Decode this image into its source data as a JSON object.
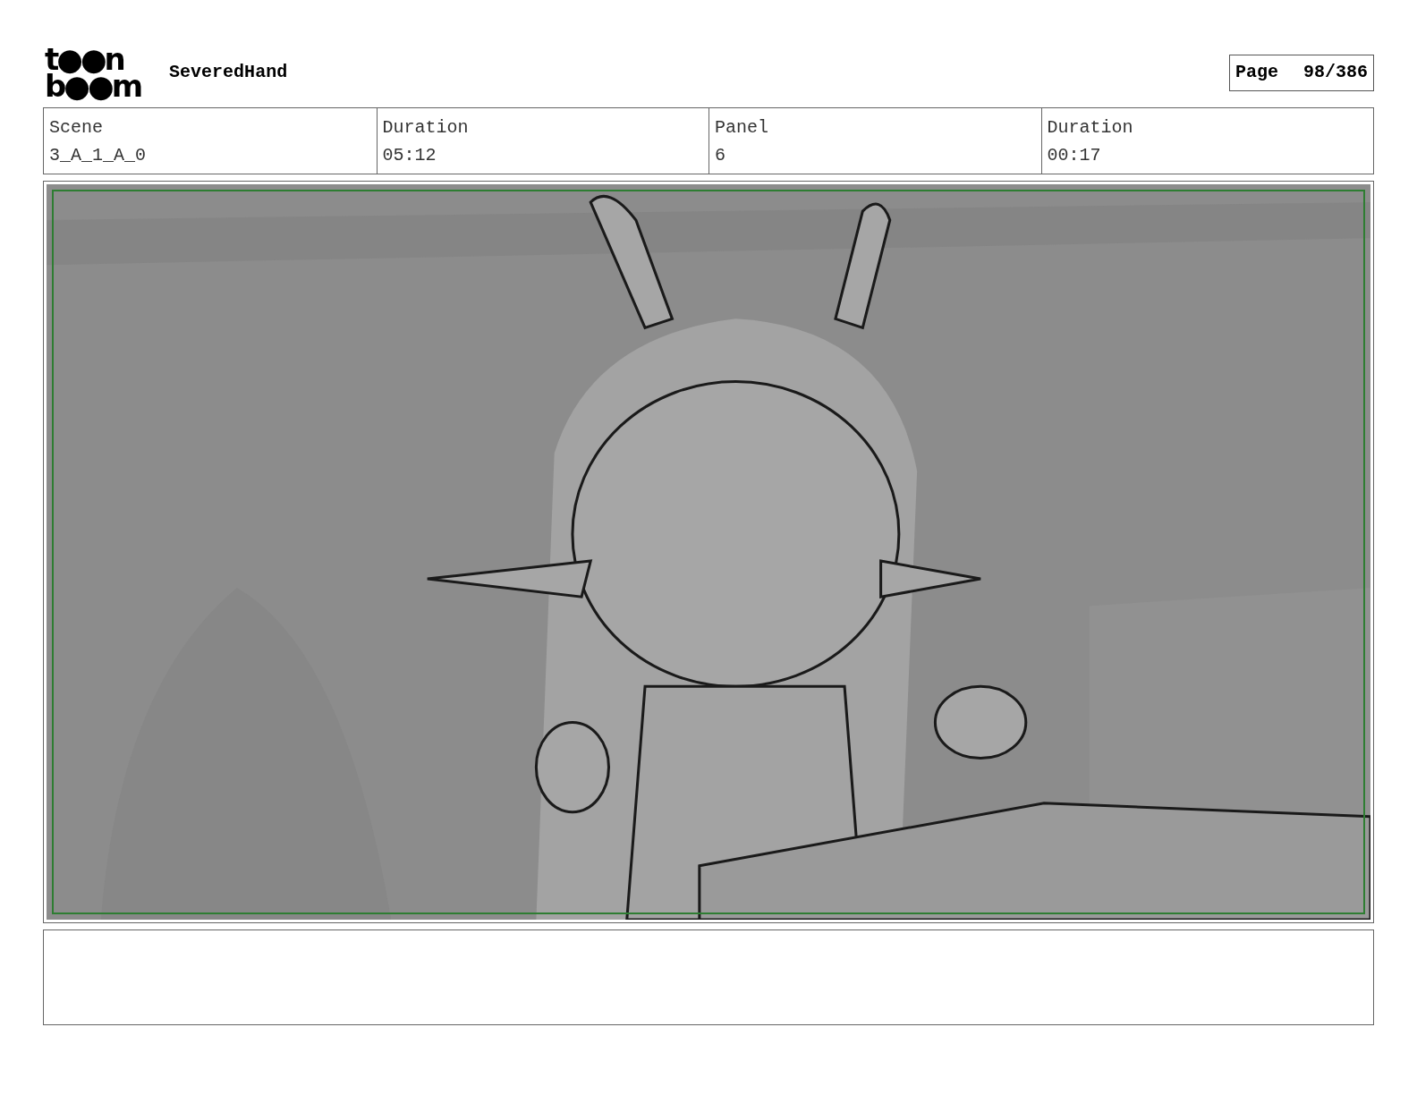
{
  "logo": {
    "line_1": "t●●n",
    "line_2": "b●●m"
  },
  "title": "SeveredHand",
  "page": {
    "label": "Page",
    "number": "98/386"
  },
  "fields": [
    {
      "label": "Scene",
      "value": "3_A_1_A_0"
    },
    {
      "label": "Duration",
      "value": "05:12"
    },
    {
      "label": "Panel",
      "value": "6"
    },
    {
      "label": "Duration",
      "value": "00:17"
    }
  ]
}
